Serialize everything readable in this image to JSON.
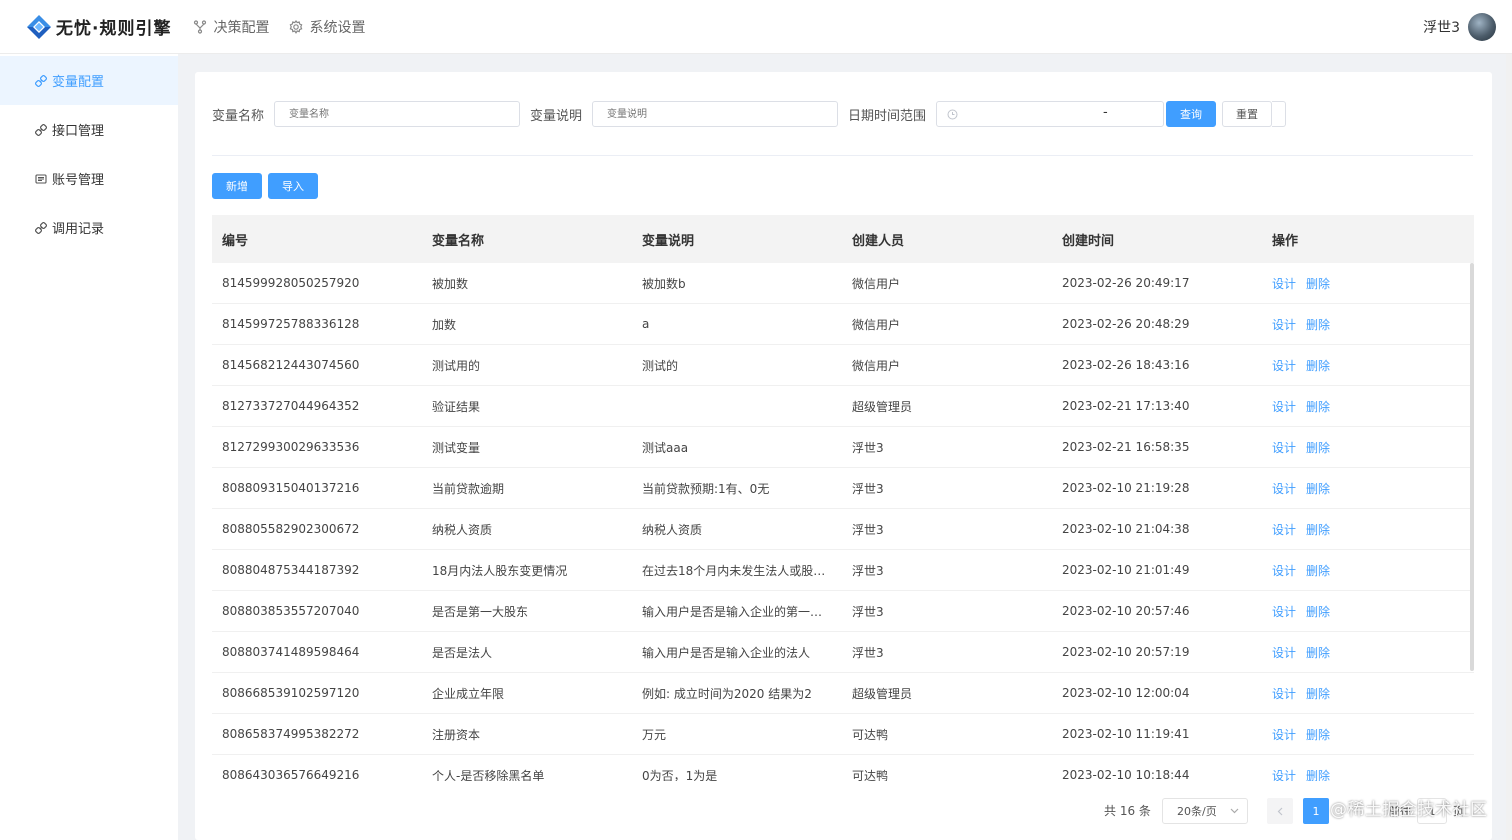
{
  "app": {
    "title": "无忧·规则引擎"
  },
  "topnav": [
    {
      "label": "决策配置",
      "icon": "branch-icon"
    },
    {
      "label": "系统设置",
      "icon": "gear-icon"
    }
  ],
  "user": {
    "name": "浮世3"
  },
  "sidebar": {
    "items": [
      {
        "label": "变量配置",
        "icon": "link-icon",
        "active": true
      },
      {
        "label": "接口管理",
        "icon": "link-icon",
        "active": false
      },
      {
        "label": "账号管理",
        "icon": "list-icon",
        "active": false
      },
      {
        "label": "调用记录",
        "icon": "link-icon",
        "active": false
      }
    ]
  },
  "search": {
    "name_label": "变量名称",
    "name_placeholder": "变量名称",
    "desc_label": "变量说明",
    "desc_placeholder": "变量说明",
    "date_label": "日期时间范围",
    "date_separator": "-",
    "query_label": "查询",
    "reset_label": "重置"
  },
  "actions": {
    "add_label": "新增",
    "import_label": "导入"
  },
  "table": {
    "columns": [
      "编号",
      "变量名称",
      "变量说明",
      "创建人员",
      "创建时间",
      "操作"
    ],
    "op_design": "设计",
    "op_delete": "删除",
    "rows": [
      [
        "814599928050257920",
        "被加数",
        "被加数b",
        "微信用户",
        "2023-02-26 20:49:17"
      ],
      [
        "814599725788336128",
        "加数",
        "a",
        "微信用户",
        "2023-02-26 20:48:29"
      ],
      [
        "814568212443074560",
        "测试用的",
        "测试的",
        "微信用户",
        "2023-02-26 18:43:16"
      ],
      [
        "812733727044964352",
        "验证结果",
        "",
        "超级管理员",
        "2023-02-21 17:13:40"
      ],
      [
        "812729930029633536",
        "测试变量",
        "测试aaa",
        "浮世3",
        "2023-02-21 16:58:35"
      ],
      [
        "808809315040137216",
        "当前贷款逾期",
        "当前贷款预期:1有、0无",
        "浮世3",
        "2023-02-10 21:19:28"
      ],
      [
        "808805582902300672",
        "纳税人资质",
        "纳税人资质",
        "浮世3",
        "2023-02-10 21:04:38"
      ],
      [
        "808804875344187392",
        "18月内法人股东变更情况",
        "在过去18个月内未发生法人或股…",
        "浮世3",
        "2023-02-10 21:01:49"
      ],
      [
        "808803853557207040",
        "是否是第一大股东",
        "输入用户是否是输入企业的第一…",
        "浮世3",
        "2023-02-10 20:57:46"
      ],
      [
        "808803741489598464",
        "是否是法人",
        "输入用户是否是输入企业的法人",
        "浮世3",
        "2023-02-10 20:57:19"
      ],
      [
        "808668539102597120",
        "企业成立年限",
        "例如: 成立时间为2020 结果为2",
        "超级管理员",
        "2023-02-10 12:00:04"
      ],
      [
        "808658374995382272",
        "注册资本",
        "万元",
        "可达鸭",
        "2023-02-10 11:19:41"
      ],
      [
        "808643036576649216",
        "个人-是否移除黑名单",
        "0为否，1为是",
        "可达鸭",
        "2023-02-10 10:18:44"
      ]
    ]
  },
  "pagination": {
    "total_text": "共 16 条",
    "page_size_text": "20条/页",
    "current_page": "1",
    "goto_prefix": "前往",
    "goto_value": "1",
    "goto_suffix": "页"
  },
  "watermark": "@稀土掘金技术社区",
  "colors": {
    "primary": "#409eff",
    "active_bg": "#ecf5ff",
    "header_bg": "#f3f3f3"
  }
}
